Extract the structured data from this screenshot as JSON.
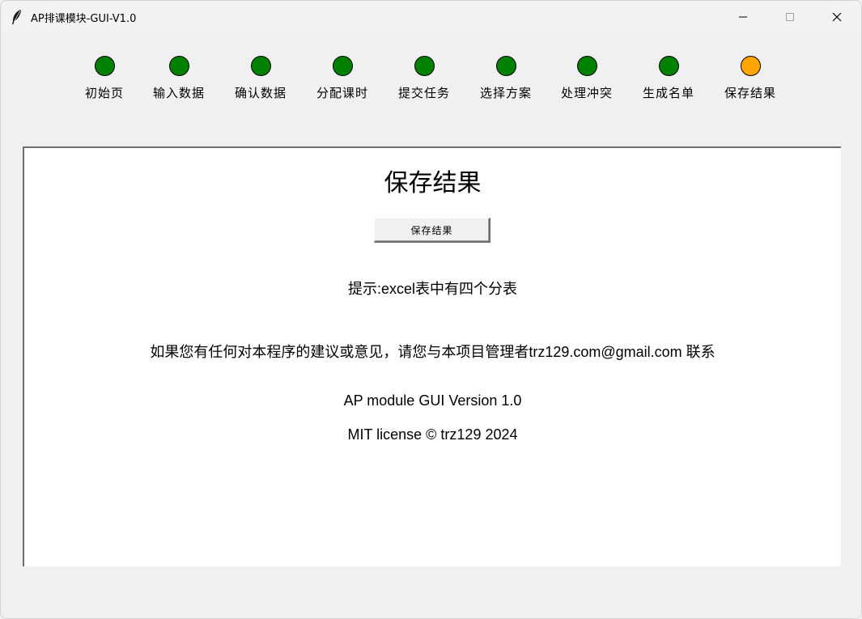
{
  "window": {
    "title": "AP排课模块-GUI-V1.0",
    "icon": "feather-icon"
  },
  "steps": [
    {
      "label": "初始页",
      "status": "done"
    },
    {
      "label": "输入数据",
      "status": "done"
    },
    {
      "label": "确认数据",
      "status": "done"
    },
    {
      "label": "分配课时",
      "status": "done"
    },
    {
      "label": "提交任务",
      "status": "done"
    },
    {
      "label": "选择方案",
      "status": "done"
    },
    {
      "label": "处理冲突",
      "status": "done"
    },
    {
      "label": "生成名单",
      "status": "done"
    },
    {
      "label": "保存结果",
      "status": "current"
    }
  ],
  "colors": {
    "done": "#008000",
    "current": "#ffa500"
  },
  "main": {
    "title": "保存结果",
    "save_button": "保存结果",
    "hint": "提示:excel表中有四个分表",
    "feedback": "如果您有任何对本程序的建议或意见，请您与本项目管理者trz129.com@gmail.com 联系",
    "version": "AP module GUI Version 1.0",
    "license": "MIT license © trz129 2024"
  }
}
